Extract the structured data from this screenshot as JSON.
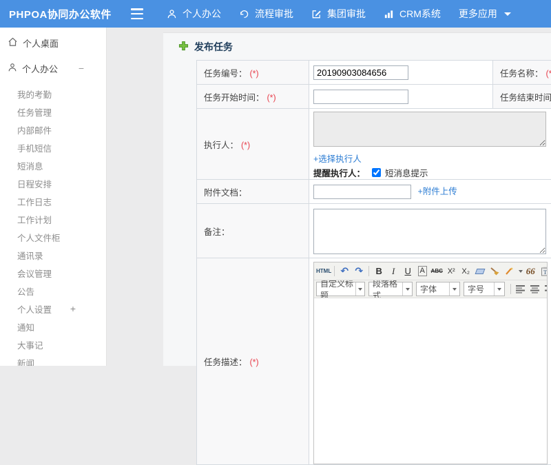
{
  "header": {
    "brand": "PHPOA协同办公软件",
    "nav": [
      {
        "label": "个人办公",
        "icon": "user-icon"
      },
      {
        "label": "流程审批",
        "icon": "history-icon"
      },
      {
        "label": "集团审批",
        "icon": "edit-icon"
      },
      {
        "label": "CRM系统",
        "icon": "bar-chart-icon"
      },
      {
        "label": "更多应用",
        "icon": "caret-down-icon"
      }
    ]
  },
  "sidebar": {
    "desktop_label": "个人桌面",
    "office_label": "个人办公",
    "collapse_symbol": "−",
    "expand_symbol": "+",
    "items": [
      "我的考勤",
      "任务管理",
      "内部邮件",
      "手机短信",
      "短消息",
      "日程安排",
      "工作日志",
      "工作计划",
      "个人文件柜",
      "通讯录",
      "会议管理",
      "公告",
      "个人设置",
      "通知",
      "大事记",
      "新闻"
    ]
  },
  "main": {
    "title": "发布任务",
    "required_marker": "(*)",
    "fields": {
      "task_no_label": "任务编号：",
      "task_no_value": "20190903084656",
      "task_name_label": "任务名称：",
      "start_label": "任务开始时间：",
      "end_label": "任务结束时间：",
      "executor_label": "执行人：",
      "choose_executor_link": "+选择执行人",
      "remind_label": "提醒执行人：",
      "sms_checkbox_label": "短消息提示",
      "attachment_label": "附件文档：",
      "attachment_upload_link": "+附件上传",
      "remark_label": "备注：",
      "desc_label": "任务描述："
    },
    "editor": {
      "html_btn": "HTML",
      "bold": "B",
      "italic": "I",
      "underline": "U",
      "font_bg": "A",
      "strike": "ABC",
      "superscript": "X²",
      "subscript": "X₂",
      "quote": "66",
      "font_color": "A",
      "dropdowns": [
        "自定义标题",
        "段落格式",
        "字体",
        "字号"
      ]
    }
  },
  "colors": {
    "topbar": "#4a91e2",
    "link": "#2b7cd3",
    "required": "#e8434f",
    "title_text": "#1e3c5a",
    "plus_icon_green": "#79c043"
  }
}
